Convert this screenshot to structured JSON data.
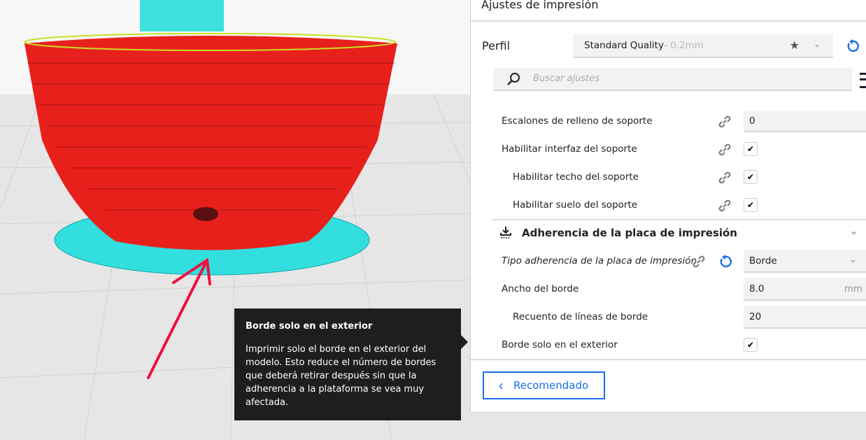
{
  "panel": {
    "title": "Ajustes de impresión",
    "profile": {
      "label": "Perfil",
      "name": "Standard Quality",
      "suffix": " - 0.2mm"
    },
    "search": {
      "placeholder": "Buscar ajustes"
    },
    "settings": [
      {
        "label": "Escalones de relleno de soporte",
        "value": "0"
      },
      {
        "label": "Habilitar interfaz del soporte",
        "checked": true
      },
      {
        "label": "Habilitar techo del soporte",
        "checked": true
      },
      {
        "label": "Habilitar suelo del soporte",
        "checked": true
      }
    ],
    "section": {
      "title": "Adherencia de la placa de impresión",
      "settings": [
        {
          "label": "Tipo adherencia de la placa de impresión",
          "value": "Borde"
        },
        {
          "label": "Ancho del borde",
          "value": "8.0",
          "unit": "mm"
        },
        {
          "label": "Recuento de líneas de borde",
          "value": "20"
        },
        {
          "label": "Borde solo en el exterior",
          "checked": true
        }
      ]
    },
    "recommended_button": "Recomendado"
  },
  "tooltip": {
    "title": "Borde solo en el exterior",
    "body": "Imprimir solo el borde en el exterior del modelo. Esto reduce el número de bordes que deberá retirar después sin que la adherencia a la plataforma se vea muy afectada."
  },
  "colors": {
    "accent": "#196ef0",
    "model": "#e8201c",
    "brim": "#33e0e0",
    "annotation": "#f0103c"
  }
}
